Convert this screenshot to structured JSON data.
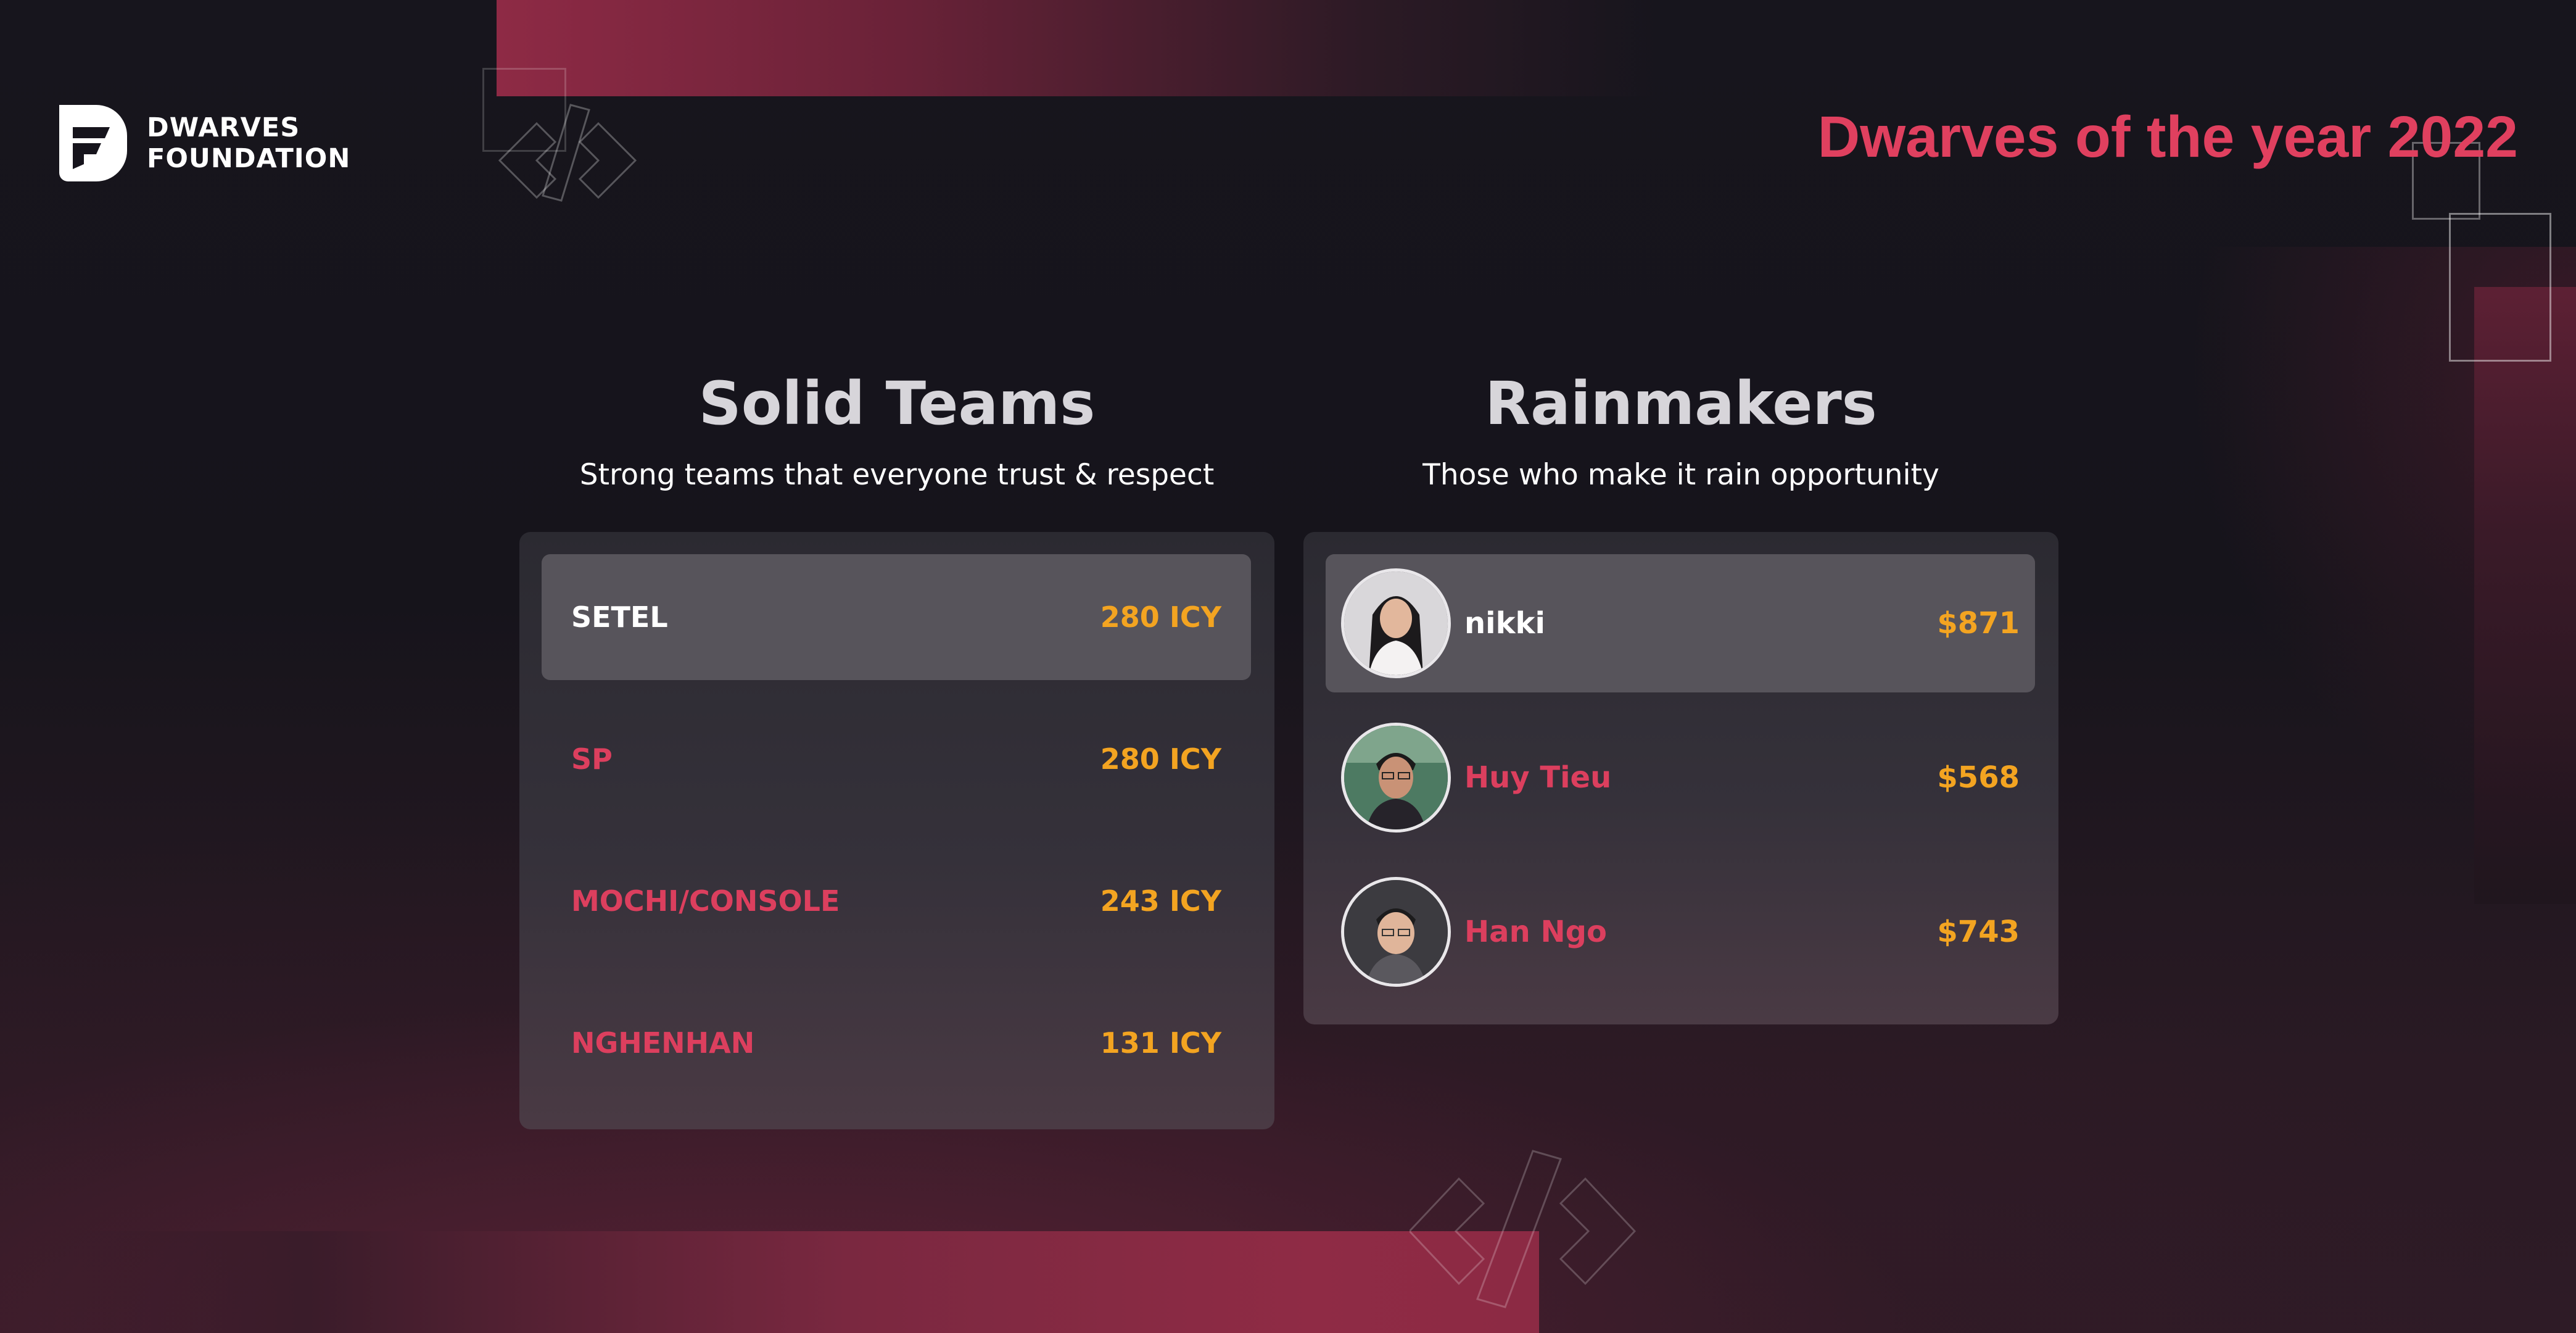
{
  "brand": {
    "logo_line1": "DWARVES",
    "logo_line2": "FOUNDATION",
    "logo_icon": "dwarves-logo-icon"
  },
  "page": {
    "title": "Dwarves of the year 2022"
  },
  "colors": {
    "accent": "#dc3f5e",
    "score": "#f3a421",
    "background": "#16141c",
    "panel": "#2f2d34",
    "highlight_row": "#57545b"
  },
  "solid_teams": {
    "title": "Solid Teams",
    "subtitle": "Strong teams that everyone trust & respect",
    "rows": [
      {
        "name": "SETEL",
        "score": "280 ICY"
      },
      {
        "name": "SP",
        "score": "280 ICY"
      },
      {
        "name": "MOCHI/CONSOLE",
        "score": "243 ICY"
      },
      {
        "name": "NGHENHAN",
        "score": "131 ICY"
      }
    ]
  },
  "rainmakers": {
    "title": "Rainmakers",
    "subtitle": "Those who make it rain opportunity",
    "rows": [
      {
        "name": "nikki",
        "amount": "$871",
        "avatar": "avatar-photo"
      },
      {
        "name": "Huy Tieu",
        "amount": "$568",
        "avatar": "avatar-photo"
      },
      {
        "name": "Han Ngo",
        "amount": "$743",
        "avatar": "avatar-photo"
      }
    ]
  },
  "decorations": {
    "code_icon": "code-brackets-icon"
  }
}
